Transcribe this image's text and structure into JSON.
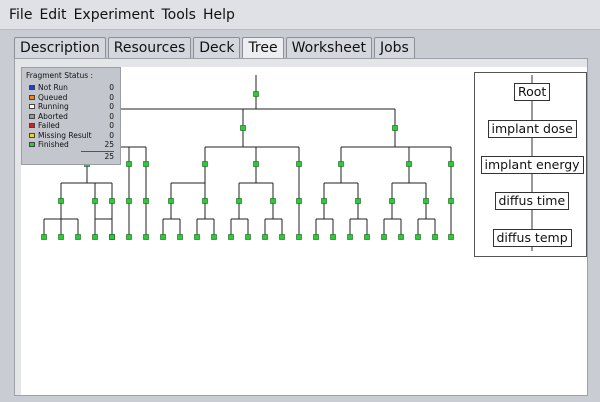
{
  "menu": [
    "File",
    "Edit",
    "Experiment",
    "Tools",
    "Help"
  ],
  "tabs": [
    {
      "label": "Description",
      "active": false
    },
    {
      "label": "Resources",
      "active": false
    },
    {
      "label": "Deck",
      "active": false
    },
    {
      "label": "Tree",
      "active": true
    },
    {
      "label": "Worksheet",
      "active": false
    },
    {
      "label": "Jobs",
      "active": false
    }
  ],
  "fragment_status": {
    "title": "Fragment Status :",
    "rows": [
      {
        "label": "Not Run",
        "value": "0",
        "color": "#1f3fd6"
      },
      {
        "label": "Queued",
        "value": "0",
        "color": "#e88a1a"
      },
      {
        "label": "Running",
        "value": "0",
        "color": "#ffffff"
      },
      {
        "label": "Aborted",
        "value": "0",
        "color": "#9a9a9a"
      },
      {
        "label": "Failed",
        "value": "0",
        "color": "#d42020"
      },
      {
        "label": "Missing Result",
        "value": "0",
        "color": "#e6d51a"
      },
      {
        "label": "Finished",
        "value": "25",
        "color": "#2cc93a"
      }
    ],
    "total": "25"
  },
  "levels": [
    "Root",
    "implant dose",
    "implant energy",
    "diffus time",
    "diffus temp"
  ],
  "colors": {
    "node": "#2cc93a",
    "line": "#222222"
  }
}
